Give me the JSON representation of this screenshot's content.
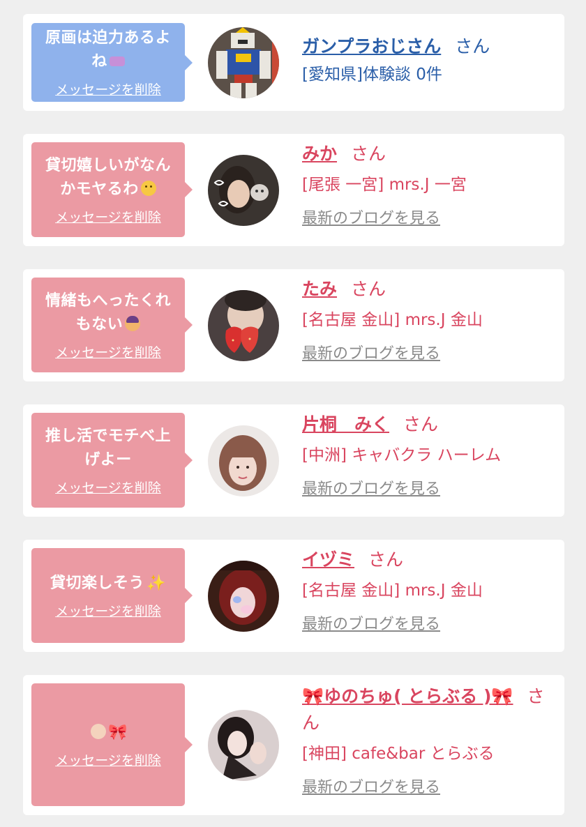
{
  "colors": {
    "blue_bubble": "#8fb2ec",
    "pink_bubble": "#eb9aa3",
    "blue_text": "#2a5ea8",
    "pink_text": "#d9455f",
    "link_gray": "#8a8a8a"
  },
  "cards": [
    {
      "message": "原画は迫力あるよね",
      "emoji": "purple-face-icon",
      "delete_label": "メッセージを削除",
      "name": "ガンプラおじさん",
      "suffix": "さん",
      "area": "[愛知県]体験談 0件",
      "blog_label": ""
    },
    {
      "message": "貸切嬉しいがなんかモヤるわ",
      "emoji": "neutral-face-icon",
      "delete_label": "メッセージを削除",
      "name": "みか",
      "suffix": "さん",
      "area": "[尾張 一宮] mrs.J 一宮",
      "blog_label": "最新のブログを見る"
    },
    {
      "message": "情緒もへったくれもない",
      "emoji": "facepalm-icon",
      "delete_label": "メッセージを削除",
      "name": "たみ",
      "suffix": "さん",
      "area": "[名古屋 金山] mrs.J 金山",
      "blog_label": "最新のブログを見る"
    },
    {
      "message": "推し活でモチベ上げよー",
      "emoji": "",
      "delete_label": "メッセージを削除",
      "name": "片桐　みく",
      "suffix": "さん",
      "area": "[中洲] キャバクラ ハーレム",
      "blog_label": "最新のブログを見る"
    },
    {
      "message": "貸切楽しそう",
      "emoji": "sparkles-icon",
      "delete_label": "メッセージを削除",
      "name": "イヅミ",
      "suffix": "さん",
      "area": "[名古屋 金山] mrs.J 金山",
      "blog_label": "最新のブログを見る"
    },
    {
      "message": "",
      "emoji": "baby-bow-icon",
      "delete_label": "メッセージを削除",
      "name": "🎀ゆのちゅ( とらぶる )🎀",
      "suffix": "さん",
      "area": "[神田] cafe&bar とらぶる",
      "blog_label": "最新のブログを見る"
    }
  ]
}
